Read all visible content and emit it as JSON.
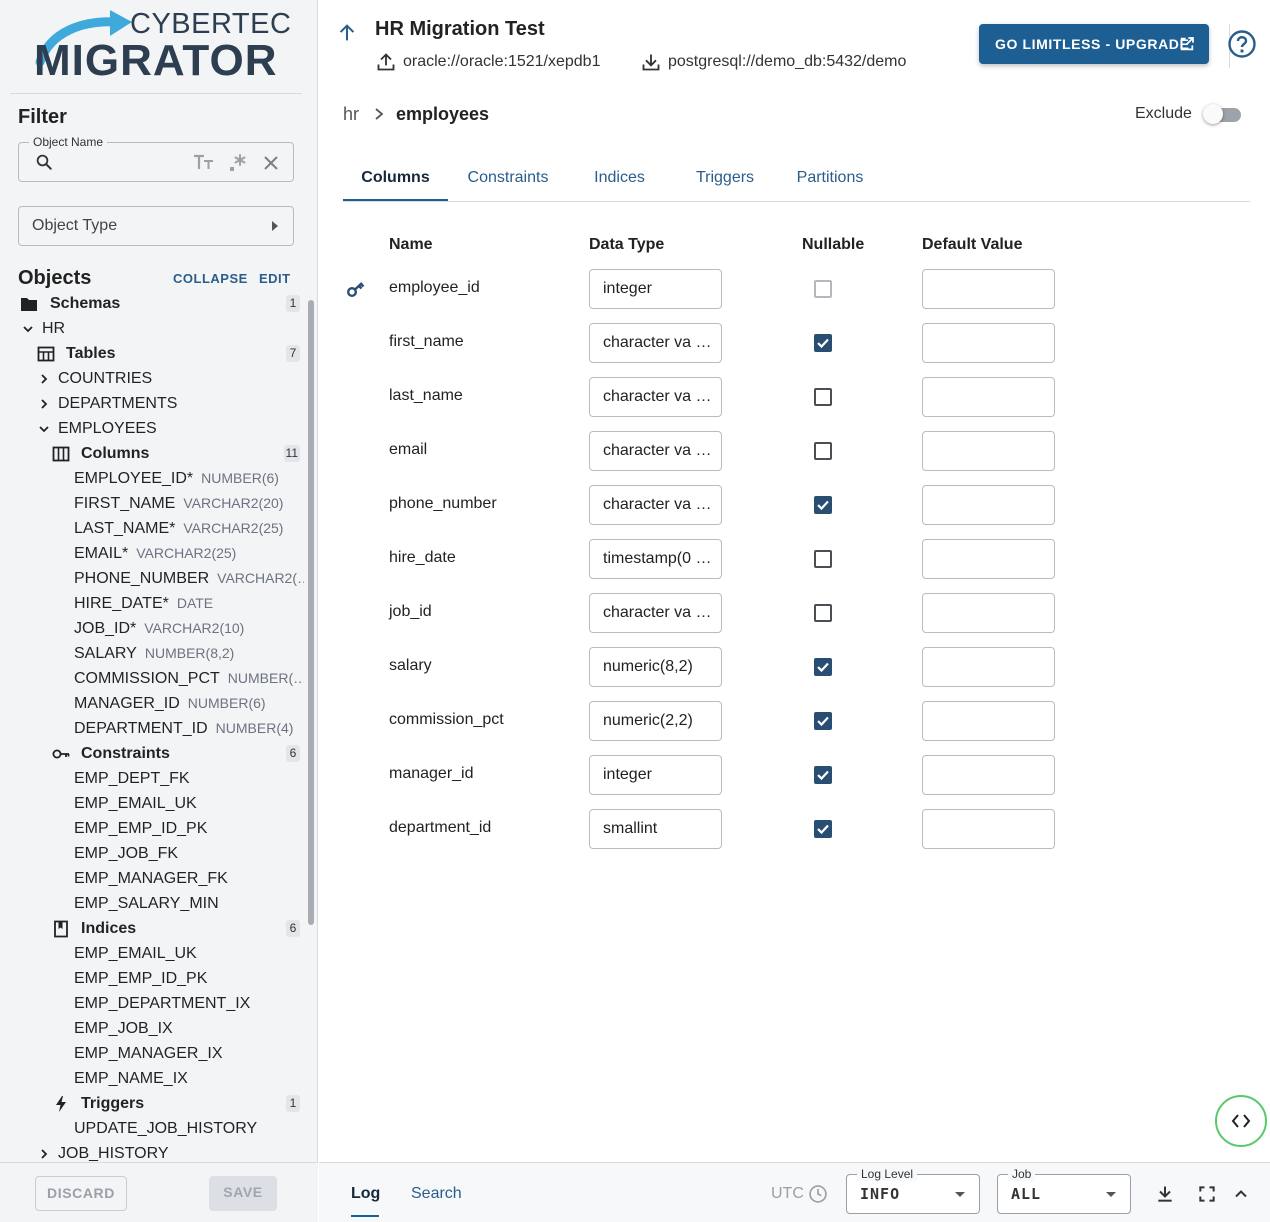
{
  "logo": {
    "brand": "CYBERTEC",
    "product": "MIGRATOR"
  },
  "filter": {
    "title": "Filter",
    "object_name_legend": "Object Name",
    "object_type_label": "Object Type"
  },
  "objects": {
    "title": "Objects",
    "collapse_label": "COLLAPSE",
    "edit_label": "EDIT"
  },
  "tree": [
    {
      "label": "Schemas",
      "count": "1",
      "bold": true,
      "icon": "folder-icon",
      "level": 0
    },
    {
      "label": "HR",
      "chev": "down",
      "level": 1
    },
    {
      "label": "Tables",
      "count": "7",
      "bold": true,
      "icon": "table-icon",
      "level": 2
    },
    {
      "label": "COUNTRIES",
      "chev": "right",
      "level": 3
    },
    {
      "label": "DEPARTMENTS",
      "chev": "right",
      "level": 3
    },
    {
      "label": "EMPLOYEES",
      "chev": "down",
      "level": 3
    },
    {
      "label": "Columns",
      "count": "11",
      "bold": true,
      "icon": "columns-icon",
      "level": 4
    },
    {
      "label": "EMPLOYEE_ID*",
      "sub": "NUMBER(6)",
      "level": 5
    },
    {
      "label": "FIRST_NAME",
      "sub": "VARCHAR2(20)",
      "level": 5
    },
    {
      "label": "LAST_NAME*",
      "sub": "VARCHAR2(25)",
      "level": 5
    },
    {
      "label": "EMAIL*",
      "sub": "VARCHAR2(25)",
      "level": 5
    },
    {
      "label": "PHONE_NUMBER",
      "sub": "VARCHAR2(…",
      "level": 5
    },
    {
      "label": "HIRE_DATE*",
      "sub": "DATE",
      "level": 5
    },
    {
      "label": "JOB_ID*",
      "sub": "VARCHAR2(10)",
      "level": 5
    },
    {
      "label": "SALARY",
      "sub": "NUMBER(8,2)",
      "level": 5
    },
    {
      "label": "COMMISSION_PCT",
      "sub": "NUMBER(…",
      "level": 5
    },
    {
      "label": "MANAGER_ID",
      "sub": "NUMBER(6)",
      "level": 5
    },
    {
      "label": "DEPARTMENT_ID",
      "sub": "NUMBER(4)",
      "level": 5
    },
    {
      "label": "Constraints",
      "count": "6",
      "bold": true,
      "icon": "key-icon",
      "level": 4
    },
    {
      "label": "EMP_DEPT_FK",
      "level": 5
    },
    {
      "label": "EMP_EMAIL_UK",
      "level": 5
    },
    {
      "label": "EMP_EMP_ID_PK",
      "level": 5
    },
    {
      "label": "EMP_JOB_FK",
      "level": 5
    },
    {
      "label": "EMP_MANAGER_FK",
      "level": 5
    },
    {
      "label": "EMP_SALARY_MIN",
      "level": 5
    },
    {
      "label": "Indices",
      "count": "6",
      "bold": true,
      "icon": "bookmark-icon",
      "level": 4
    },
    {
      "label": "EMP_EMAIL_UK",
      "level": 5
    },
    {
      "label": "EMP_EMP_ID_PK",
      "level": 5
    },
    {
      "label": "EMP_DEPARTMENT_IX",
      "level": 5
    },
    {
      "label": "EMP_JOB_IX",
      "level": 5
    },
    {
      "label": "EMP_MANAGER_IX",
      "level": 5
    },
    {
      "label": "EMP_NAME_IX",
      "level": 5
    },
    {
      "label": "Triggers",
      "count": "1",
      "bold": true,
      "icon": "bolt-icon",
      "level": 4
    },
    {
      "label": "UPDATE_JOB_HISTORY",
      "level": 5
    },
    {
      "label": "JOB_HISTORY",
      "chev": "right",
      "level": 3
    }
  ],
  "footer": {
    "discard_label": "DISCARD",
    "save_label": "SAVE"
  },
  "header": {
    "title": "HR Migration Test",
    "source": "oracle://oracle:1521/xepdb1",
    "target": "postgresql://demo_db:5432/demo",
    "upgrade_label": "GO LIMITLESS - UPGRADE"
  },
  "breadcrumb": {
    "schema": "hr",
    "table": "employees"
  },
  "exclude": {
    "label": "Exclude",
    "on": false
  },
  "tabs": [
    "Columns",
    "Constraints",
    "Indices",
    "Triggers",
    "Partitions"
  ],
  "table": {
    "headers": {
      "name": "Name",
      "data_type": "Data Type",
      "nullable": "Nullable",
      "default": "Default Value"
    },
    "rows": [
      {
        "name": "employee_id",
        "data_type": "integer",
        "nullable": "disabled",
        "pk": true
      },
      {
        "name": "first_name",
        "data_type": "character va …",
        "nullable": "checked"
      },
      {
        "name": "last_name",
        "data_type": "character va …",
        "nullable": "unchecked"
      },
      {
        "name": "email",
        "data_type": "character va …",
        "nullable": "unchecked"
      },
      {
        "name": "phone_number",
        "data_type": "character va …",
        "nullable": "checked"
      },
      {
        "name": "hire_date",
        "data_type": "timestamp(0 …",
        "nullable": "unchecked"
      },
      {
        "name": "job_id",
        "data_type": "character va …",
        "nullable": "unchecked"
      },
      {
        "name": "salary",
        "data_type": "numeric(8,2)",
        "nullable": "checked"
      },
      {
        "name": "commission_pct",
        "data_type": "numeric(2,2)",
        "nullable": "checked"
      },
      {
        "name": "manager_id",
        "data_type": "integer",
        "nullable": "checked"
      },
      {
        "name": "department_id",
        "data_type": "smallint",
        "nullable": "checked"
      }
    ]
  },
  "logbar": {
    "log_tab": "Log",
    "search_tab": "Search",
    "utc_label": "UTC",
    "log_level_legend": "Log Level",
    "log_level_value": "INFO",
    "job_legend": "Job",
    "job_value": "ALL"
  },
  "colors": {
    "accent": "#1d5e93",
    "checkbox": "#2a4e73",
    "sidebar_bg": "#f3f4f6",
    "code_button_ring": "#58c96b"
  }
}
